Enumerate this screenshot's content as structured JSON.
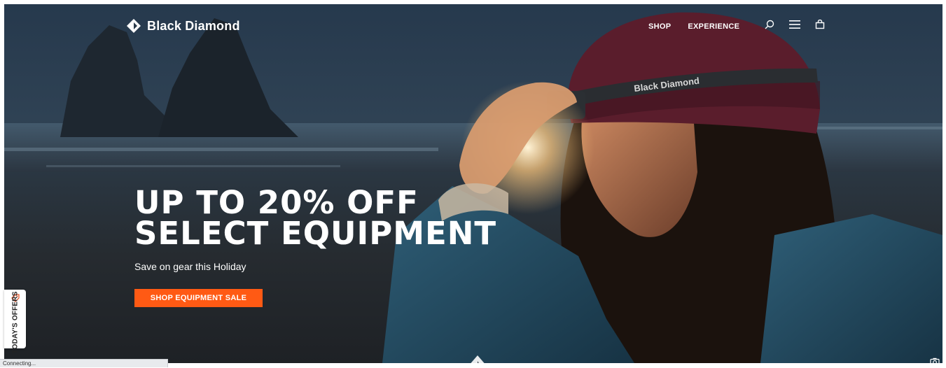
{
  "brand": {
    "name": "Black Diamond",
    "icon": "diamond-logo-icon"
  },
  "nav": {
    "items": [
      {
        "label": "SHOP"
      },
      {
        "label": "EXPERIENCE"
      }
    ]
  },
  "header_icons": [
    "search-icon",
    "menu-icon",
    "shopping-bag-icon"
  ],
  "hero": {
    "headline_line1": "UP TO 20% OFF",
    "headline_line2": "SELECT EQUIPMENT",
    "subheadline": "Save on gear this Holiday",
    "cta_label": "SHOP EQUIPMENT SALE",
    "headlamp_print": "Black Diamond"
  },
  "offers_tab": {
    "label": "TODAY'S OFFERS",
    "icon": "tag-icon"
  },
  "status": {
    "text": "Connecting..."
  },
  "colors": {
    "accent": "#ff5a14",
    "text": "#ffffff",
    "beanie": "#5a1d2c"
  }
}
